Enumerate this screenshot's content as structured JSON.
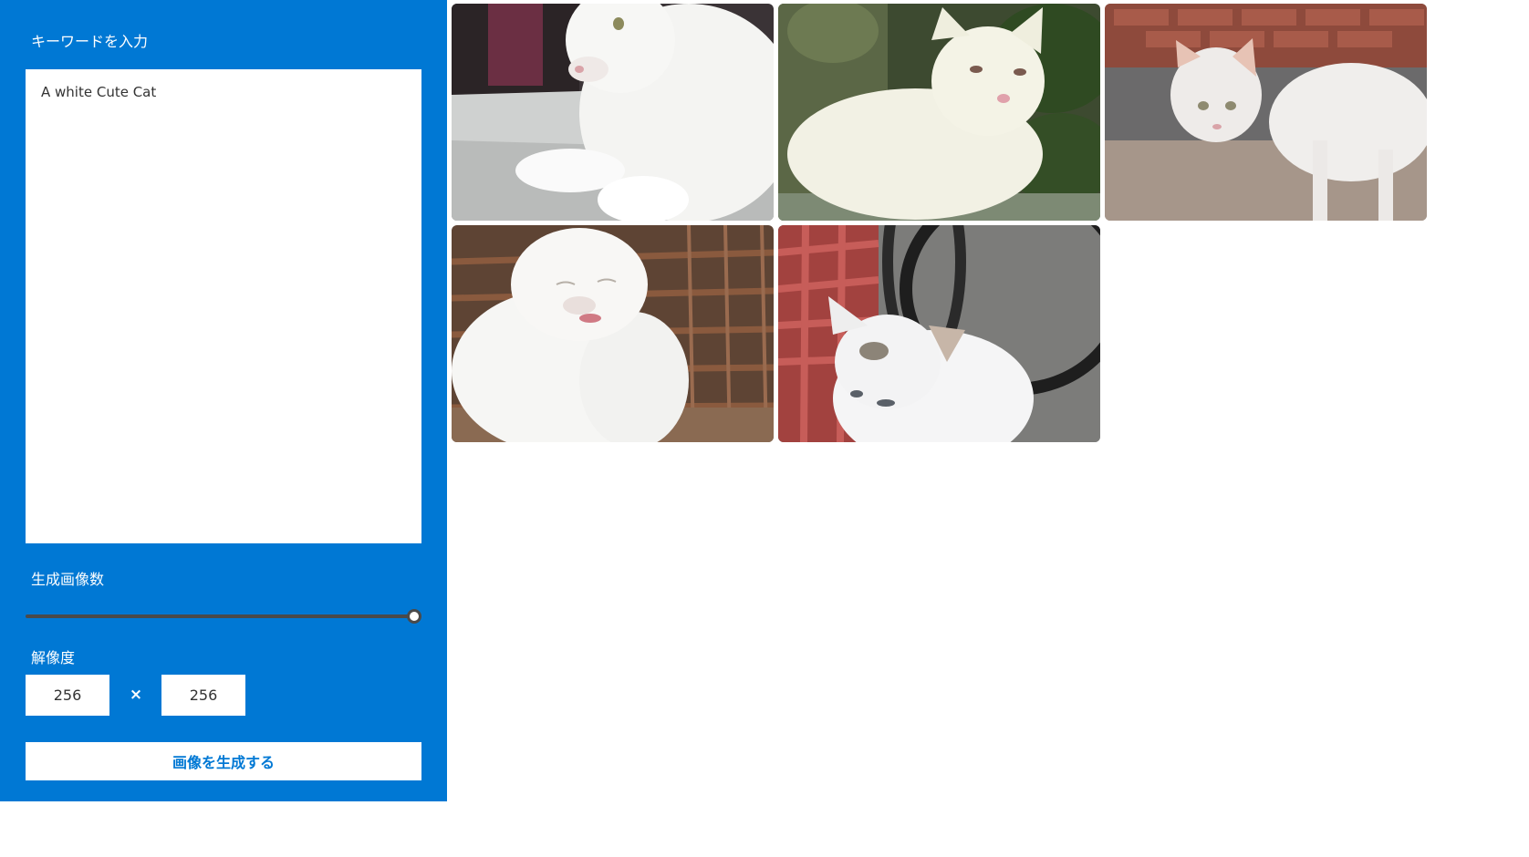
{
  "sidebar": {
    "keyword_label": "キーワードを入力",
    "prompt_value": "A white Cute Cat",
    "count_label": "生成画像数",
    "count_slider_fraction": 1.0,
    "resolution_label": "解像度",
    "width_value": "256",
    "times_symbol": "×",
    "height_value": "256",
    "generate_label": "画像を生成する",
    "accent_color": "#0078d4"
  },
  "gallery": {
    "images": [
      {
        "name": "generated-cat-image-1",
        "subject": "white cat lying on tiled floor"
      },
      {
        "name": "generated-cat-image-2",
        "subject": "white cat sitting in front of green plants"
      },
      {
        "name": "generated-cat-image-3",
        "subject": "white cat standing by brick wall"
      },
      {
        "name": "generated-cat-image-4",
        "subject": "white cat sitting by rusty bars"
      },
      {
        "name": "generated-cat-image-5",
        "subject": "white cat near red stool and bicycle wheel"
      }
    ]
  }
}
